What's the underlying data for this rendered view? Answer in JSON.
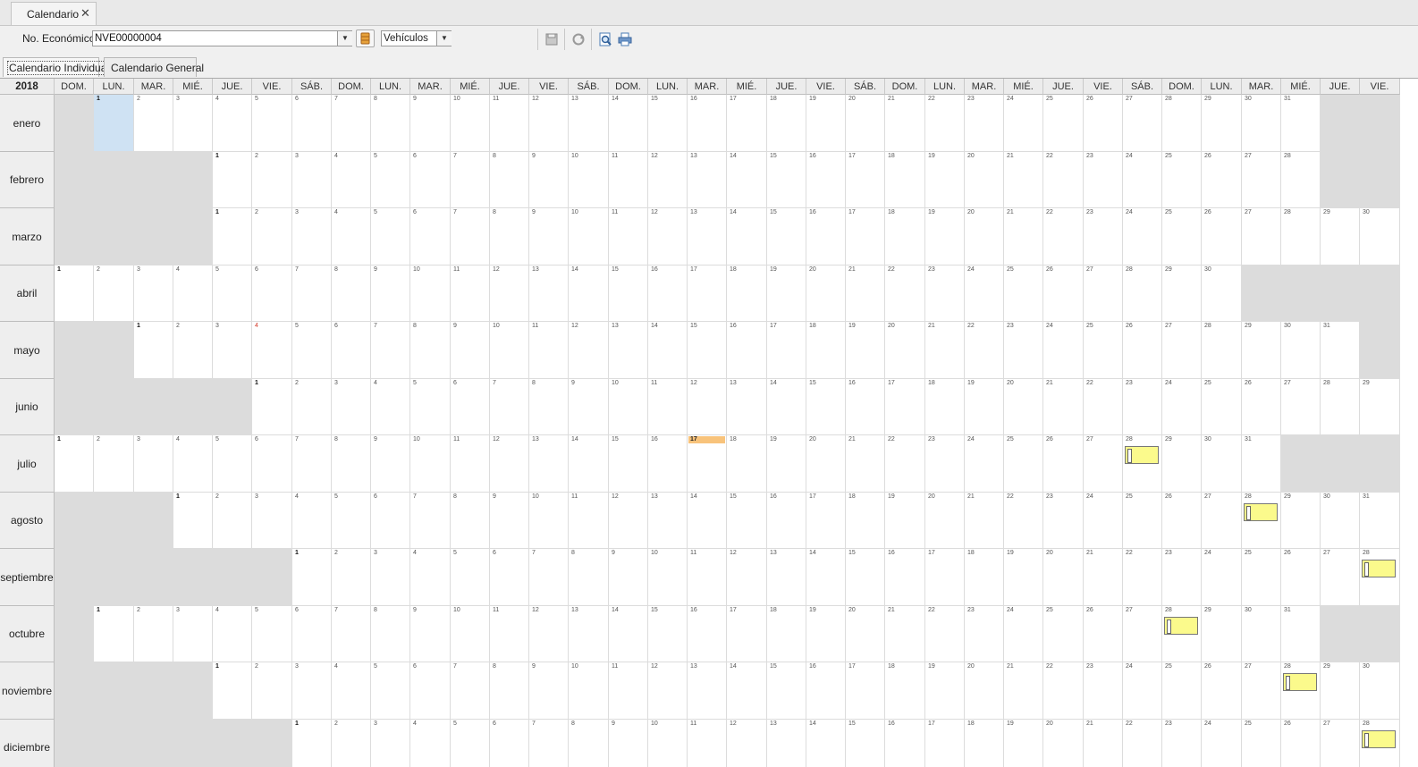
{
  "window": {
    "tab_title": "Calendario",
    "close_icon": "close-icon"
  },
  "toolbar": {
    "eco_label": "No. Económico:",
    "eco_value": "NVE00000004",
    "type_value": "Vehículos",
    "icons": [
      "database-icon",
      "save-icon",
      "refresh-icon",
      "preview-icon",
      "print-icon"
    ]
  },
  "subtabs": [
    "Calendario Individual",
    "Calendario General"
  ],
  "calendar": {
    "year": "2018",
    "weekdays": [
      "DOM.",
      "LUN.",
      "MAR.",
      "MIÉ.",
      "JUE.",
      "VIE.",
      "SÁB.",
      "DOM.",
      "LUN.",
      "MAR.",
      "MIÉ.",
      "JUE.",
      "VIE.",
      "SÁB.",
      "DOM.",
      "LUN.",
      "MAR.",
      "MIÉ.",
      "JUE.",
      "VIE.",
      "SÁB.",
      "DOM.",
      "LUN.",
      "MAR.",
      "MIÉ.",
      "JUE.",
      "VIE.",
      "SÁB.",
      "DOM.",
      "LUN.",
      "MAR.",
      "MIÉ.",
      "JUE.",
      "VIE."
    ],
    "months": [
      {
        "name": "enero",
        "start": 1,
        "days": 31
      },
      {
        "name": "febrero",
        "start": 4,
        "days": 28
      },
      {
        "name": "marzo",
        "start": 4,
        "days": 31
      },
      {
        "name": "abril",
        "start": 0,
        "days": 30
      },
      {
        "name": "mayo",
        "start": 2,
        "days": 31
      },
      {
        "name": "junio",
        "start": 5,
        "days": 30
      },
      {
        "name": "julio",
        "start": 0,
        "days": 31
      },
      {
        "name": "agosto",
        "start": 3,
        "days": 31
      },
      {
        "name": "septiembre",
        "start": 6,
        "days": 30
      },
      {
        "name": "octubre",
        "start": 1,
        "days": 31
      },
      {
        "name": "noviembre",
        "start": 4,
        "days": 30
      },
      {
        "name": "diciembre",
        "start": 6,
        "days": 31
      }
    ],
    "selected": {
      "month": 0,
      "day": 1
    },
    "today": {
      "month": 6,
      "day": 17
    },
    "holiday": {
      "month": 4,
      "day": 4
    },
    "events": [
      {
        "month": 6,
        "day": 28
      },
      {
        "month": 7,
        "day": 28
      },
      {
        "month": 8,
        "day": 28
      },
      {
        "month": 9,
        "day": 28
      },
      {
        "month": 10,
        "day": 28
      },
      {
        "month": 11,
        "day": 28
      }
    ],
    "colors": {
      "disabled": "#dcdcdc",
      "selected": "#cfe2f3",
      "today": "#f8c37b",
      "event": "#fbfa8c",
      "holiday_text": "#d43b2a"
    }
  }
}
